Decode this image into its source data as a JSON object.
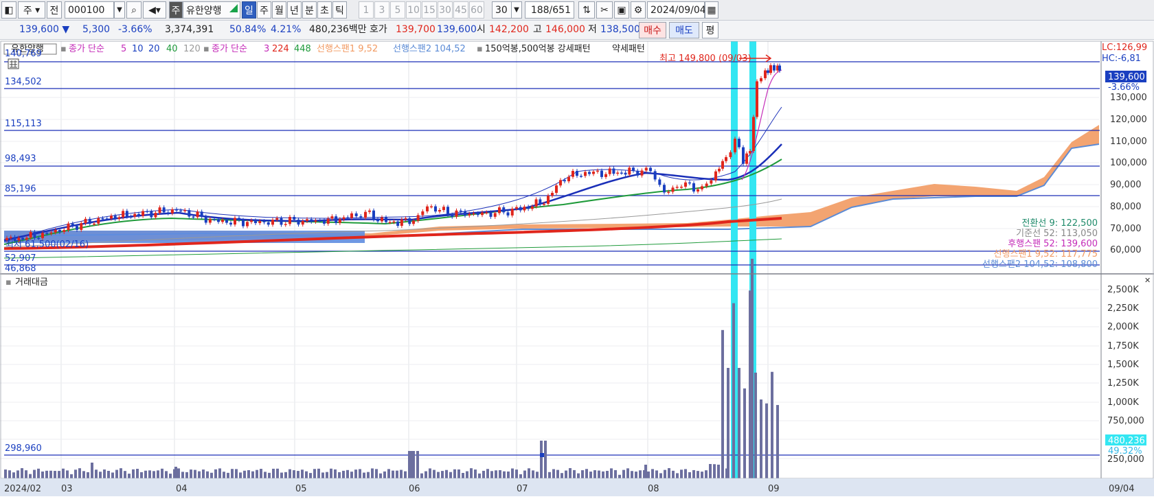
{
  "toolbar": {
    "lead_icon": "chart-layout-icon",
    "jong_label": "주",
    "jeon_label": "전",
    "code": "000100",
    "search_icon": "magnifier-icon",
    "sound_icon": "speaker-icon",
    "market_badge": "주",
    "stock_name": "유한양행",
    "periods": [
      "일",
      "주",
      "월",
      "년",
      "분",
      "초",
      "틱"
    ],
    "active_period": "일",
    "intervals": [
      "1",
      "3",
      "5",
      "10",
      "15",
      "30",
      "45",
      "60"
    ],
    "interval_select": "30",
    "count_current": "188",
    "count_total": "/651",
    "date": "2024/09/04",
    "calendar_icon": "calendar-icon"
  },
  "quote": {
    "price": "139,600",
    "arrow": "▼",
    "change": "5,300",
    "pct": "-3.66%",
    "volume": "3,374,391",
    "turnover_rate": "50.84%",
    "pct2": "4.21%",
    "amount": "480,236백만",
    "hoga_label": "호가",
    "ask": "139,700",
    "bid": "139,600",
    "open_label": "시",
    "open": "142,200",
    "high_label": "고",
    "high": "146,000",
    "low_label": "저",
    "low": "138,500",
    "buy_label": "매수",
    "sell_label": "매도",
    "eval_label": "평"
  },
  "colors": {
    "up": "#e0261c",
    "down": "#1a3fc0",
    "accent": "#2f5fbf",
    "cloud": "#f29a62",
    "highlight": "#33e6f2",
    "volume": "#6c6f9f"
  },
  "legend": {
    "title": "유한양행",
    "ma_label": "종가 단순",
    "ma_periods": [
      "5",
      "10",
      "20",
      "40",
      "120"
    ],
    "ma2_label": "종가 단순",
    "ma2_periods": [
      "3",
      "224",
      "448"
    ],
    "span1": "선행스팬1 9,52",
    "span2": "선행스팬2 104,52",
    "pattern": "150억봉,500억봉 강세패턴",
    "pattern2": "약세패턴"
  },
  "price_lines": [
    "140,769",
    "134,502",
    "115,113",
    "98,493",
    "85,196",
    "52,907",
    "46,868"
  ],
  "annotations": {
    "high": "최고 149,800 (09/03)",
    "low": "최저 61,500(02/16)"
  },
  "right": {
    "lc": "LC:126,99",
    "hc": "HC:-6,81",
    "price_tag": "139,600",
    "pct_tag": "-3.66%"
  },
  "y_axis": [
    "130,000",
    "120,000",
    "110,000",
    "100,000",
    "90,000",
    "80,000",
    "70,000",
    "60,000"
  ],
  "ichimoku": [
    "전환선 9: 122,500",
    "기준선 52: 113,050",
    "후행스팬 52: 139,600",
    "선행스팬1 9,52: 117,775",
    "선행스팬2 104,52: 108,800"
  ],
  "volume_panel": {
    "title": "거래대금",
    "line_label": "298,960",
    "y_axis": [
      "2,500K",
      "2,250K",
      "2,000K",
      "1,750K",
      "1,500K",
      "1,250K",
      "1,000K",
      "750,000",
      "250,000"
    ],
    "tag": "480,236",
    "tag_pct": "49.32%"
  },
  "x_axis": [
    "2024/02",
    "03",
    "04",
    "05",
    "06",
    "07",
    "08",
    "09"
  ],
  "x_right": "09/04",
  "chart_data": {
    "type": "candlestick",
    "x": [
      "02",
      "03",
      "04",
      "05",
      "06",
      "07",
      "08",
      "09"
    ],
    "y_axis_ticks": [
      60000,
      70000,
      80000,
      90000,
      100000,
      110000,
      120000,
      130000
    ],
    "close_approx": [
      63000,
      70000,
      75000,
      71000,
      72000,
      76000,
      90000,
      96000,
      139600
    ],
    "series": [
      {
        "name": "거래대금",
        "values": [
          40000,
          120000,
          110000,
          60000,
          300000,
          320000,
          1600000,
          2550000,
          480236
        ]
      }
    ]
  }
}
